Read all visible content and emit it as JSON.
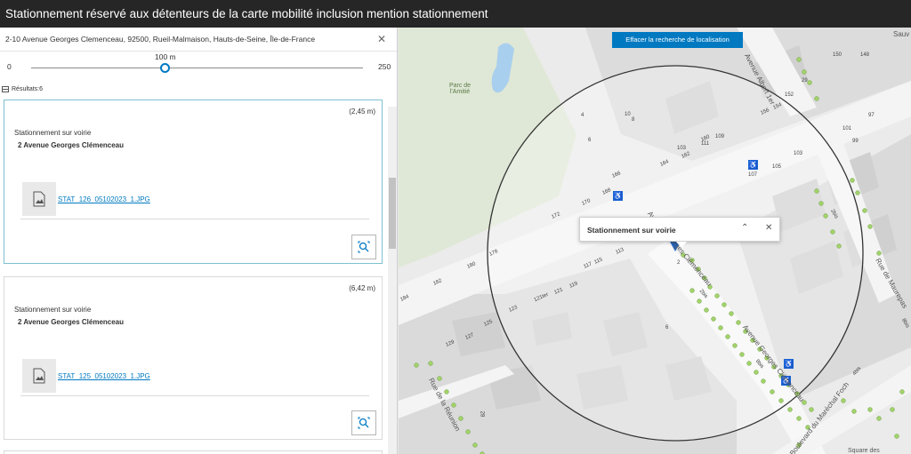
{
  "window": {
    "title": "Stationnement réservé aux détenteurs de la carte mobilité inclusion mention stationnement"
  },
  "panel": {
    "address": "2-10 Avenue Georges Clemenceau, 92500, Rueil-Malmaison, Hauts-de-Seine, Île-de-France",
    "slider": {
      "min": "0",
      "max": "250",
      "value_label": "100 m",
      "value": 100
    },
    "results_label": "Résultats:6",
    "cards": [
      {
        "distance": "(2,45 m)",
        "type": "Stationnement sur voirie",
        "street": "2 Avenue Georges Clémenceau",
        "file": "STAT_126_05102023_1.JPG"
      },
      {
        "distance": "(6,42 m)",
        "type": "Stationnement sur voirie",
        "street": "2 Avenue Georges Clémenceau",
        "file": "STAT_125_05102023_1.JPG"
      }
    ]
  },
  "map": {
    "clear_button": "Effacer la recherche de localisation",
    "popup_title": "Stationnement sur voirie",
    "park_label": "Parc de l'Amitié",
    "street_labels": {
      "albert": "Avenue Albert 1er",
      "clemenceau_top": "Avenue Georges Clémenceau",
      "clemenceau_bottom": "Avenue Georges Clémenceau",
      "reunion": "Rue de la Réunion",
      "foch": "Boulevard du Maréchal Foch",
      "maurepas": "Rue de Maurepas",
      "sauv": "Sauv",
      "square": "Square des"
    },
    "house_numbers": [
      "150",
      "148",
      "156",
      "154",
      "152",
      "164",
      "162",
      "160",
      "107",
      "105",
      "103",
      "101",
      "99",
      "97",
      "172",
      "170",
      "168",
      "166",
      "184",
      "182",
      "180",
      "178",
      "129",
      "127",
      "125",
      "123",
      "121ter",
      "121",
      "119",
      "117",
      "115",
      "113",
      "111",
      "109",
      "103",
      "10",
      "8",
      "6",
      "4",
      "2",
      "2bis",
      "8bis",
      "4bis",
      "2bis",
      "8bis",
      "6",
      "29",
      "28"
    ],
    "accent_color": "#0079c1"
  }
}
